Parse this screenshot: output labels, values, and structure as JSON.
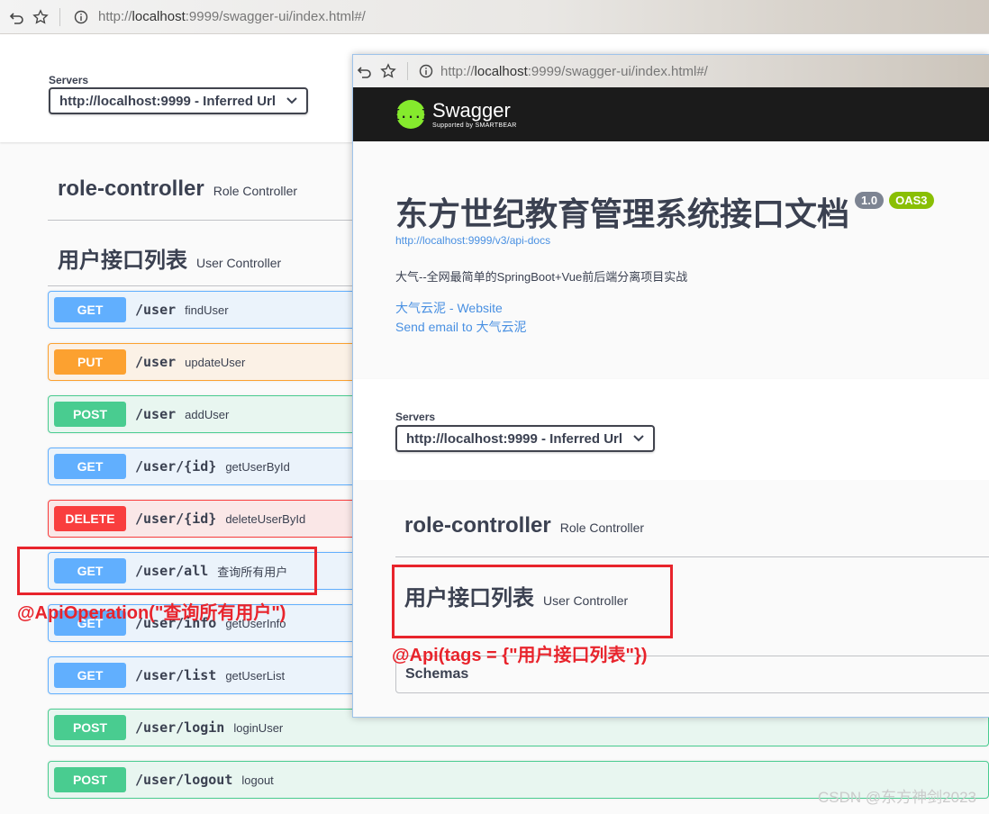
{
  "browser": {
    "url_prefix": "http://",
    "url_host": "localhost",
    "url_rest": ":9999/swagger-ui/index.html#/"
  },
  "back": {
    "servers_label": "Servers",
    "server_selected": "http://localhost:9999 - Inferred Url",
    "tags": [
      {
        "name": "role-controller",
        "desc": "Role Controller"
      },
      {
        "name": "用户接口列表",
        "desc": "User Controller"
      }
    ],
    "operations": [
      {
        "method": "GET",
        "path": "/user",
        "summary": "findUser"
      },
      {
        "method": "PUT",
        "path": "/user",
        "summary": "updateUser"
      },
      {
        "method": "POST",
        "path": "/user",
        "summary": "addUser"
      },
      {
        "method": "GET",
        "path": "/user/{id}",
        "summary": "getUserById"
      },
      {
        "method": "DELETE",
        "path": "/user/{id}",
        "summary": "deleteUserById"
      },
      {
        "method": "GET",
        "path": "/user/all",
        "summary": "查询所有用户"
      },
      {
        "method": "GET",
        "path": "/user/info",
        "summary": "getUserInfo"
      },
      {
        "method": "GET",
        "path": "/user/list",
        "summary": "getUserList"
      },
      {
        "method": "POST",
        "path": "/user/login",
        "summary": "loginUser"
      },
      {
        "method": "POST",
        "path": "/user/logout",
        "summary": "logout"
      }
    ]
  },
  "front": {
    "logo_main": "Swagger",
    "logo_sub": "Supported by SMARTBEAR",
    "logo_glyph": "{...}",
    "title": "东方世纪教育管理系统接口文档",
    "version": "1.0",
    "oas": "OAS3",
    "api_docs_url": "http://localhost:9999/v3/api-docs",
    "description": "大气--全网最简单的SpringBoot+Vue前后端分离项目实战",
    "website_link": "大气云泥 - Website",
    "email_link": "Send email to 大气云泥",
    "servers_label": "Servers",
    "server_selected": "http://localhost:9999 - Inferred Url",
    "tags": [
      {
        "name": "role-controller",
        "desc": "Role Controller"
      },
      {
        "name": "用户接口列表",
        "desc": "User Controller"
      }
    ],
    "schemas": "Schemas"
  },
  "annotations": {
    "api_operation": "@ApiOperation(\"查询所有用户\")",
    "api_tags": "@Api(tags = {\"用户接口列表\"})"
  },
  "watermark": "CSDN @东方神剑2023",
  "colors": {
    "get": "#61affe",
    "put": "#fca130",
    "post": "#49cc90",
    "delete": "#f93e3e",
    "annotation_red": "#e8242c",
    "swagger_green": "#85ea2d"
  }
}
